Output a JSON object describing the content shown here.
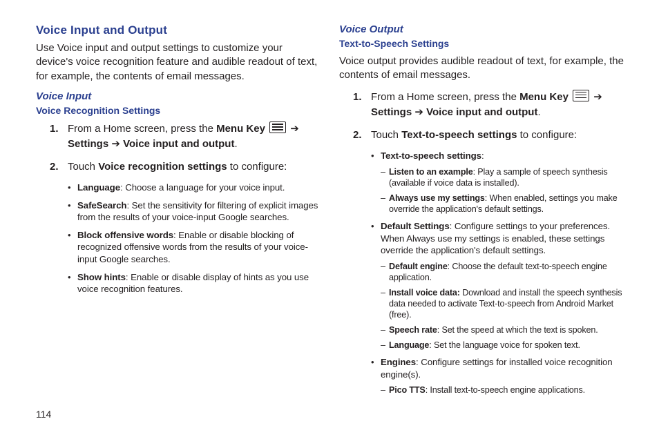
{
  "page_number": "114",
  "left": {
    "h1": "Voice Input and Output",
    "intro": "Use Voice input and output settings to customize your device's voice recognition feature and audible readout of text, for example, the contents of email messages.",
    "h2": "Voice Input",
    "h3": "Voice Recognition Settings",
    "step1_a": "From a Home screen, press the ",
    "step1_b": "Menu Key",
    "step1_c": " ➔ ",
    "step1_d": "Settings",
    "step1_e": " ➔ ",
    "step1_f": "Voice input and output",
    "step1_g": ".",
    "step2_a": "Touch ",
    "step2_b": "Voice recognition settings",
    "step2_c": " to configure:",
    "bullets": {
      "b1_t": "Language",
      "b1_d": ": Choose a language for your voice input.",
      "b2_t": "SafeSearch",
      "b2_d": ": Set the sensitivity for filtering of explicit images from the results of your voice-input Google searches.",
      "b3_t": "Block offensive words",
      "b3_d": ": Enable or disable blocking of recognized offensive words from the results of your voice-input Google searches.",
      "b4_t": "Show hints",
      "b4_d": ": Enable or disable display of hints as you use voice recognition features."
    }
  },
  "right": {
    "h2": "Voice Output",
    "h3": "Text-to-Speech Settings",
    "intro": "Voice output provides audible readout of text, for example, the contents of email messages.",
    "step1_a": "From a Home screen, press the ",
    "step1_b": "Menu Key",
    "step1_c": " ➔ ",
    "step1_d": "Settings",
    "step1_e": " ➔ ",
    "step1_f": "Voice input and output",
    "step1_g": ".",
    "step2_a": "Touch ",
    "step2_b": "Text-to-speech settings",
    "step2_c": " to configure:",
    "bullets": {
      "b1_t": "Text-to-speech settings",
      "b1_d": ":",
      "b1_sub": {
        "s1_t": "Listen to an example",
        "s1_d": ": Play a sample of speech synthesis (available if voice data is installed).",
        "s2_t": "Always use my settings",
        "s2_d": ": When enabled, settings you make override the application's default settings."
      },
      "b2_t": "Default Settings",
      "b2_d": ": Configure settings to your preferences. When Always use my settings is enabled, these settings override the application's default settings.",
      "b2_sub": {
        "s1_t": "Default engine",
        "s1_d": ": Choose the default text-to-speech engine application.",
        "s2_t": "Install voice data:",
        "s2_d": " Download and install the speech synthesis data needed to activate Text-to-speech from Android Market (free).",
        "s3_t": "Speech rate",
        "s3_d": ": Set the speed at which the text is spoken.",
        "s4_t": "Language",
        "s4_d": ": Set the language voice for spoken text."
      },
      "b3_t": "Engines",
      "b3_d": ": Configure settings for installed voice recognition engine(s).",
      "b3_sub": {
        "s1_t": "Pico TTS",
        "s1_d": ": Install text-to-speech engine applications."
      }
    }
  }
}
